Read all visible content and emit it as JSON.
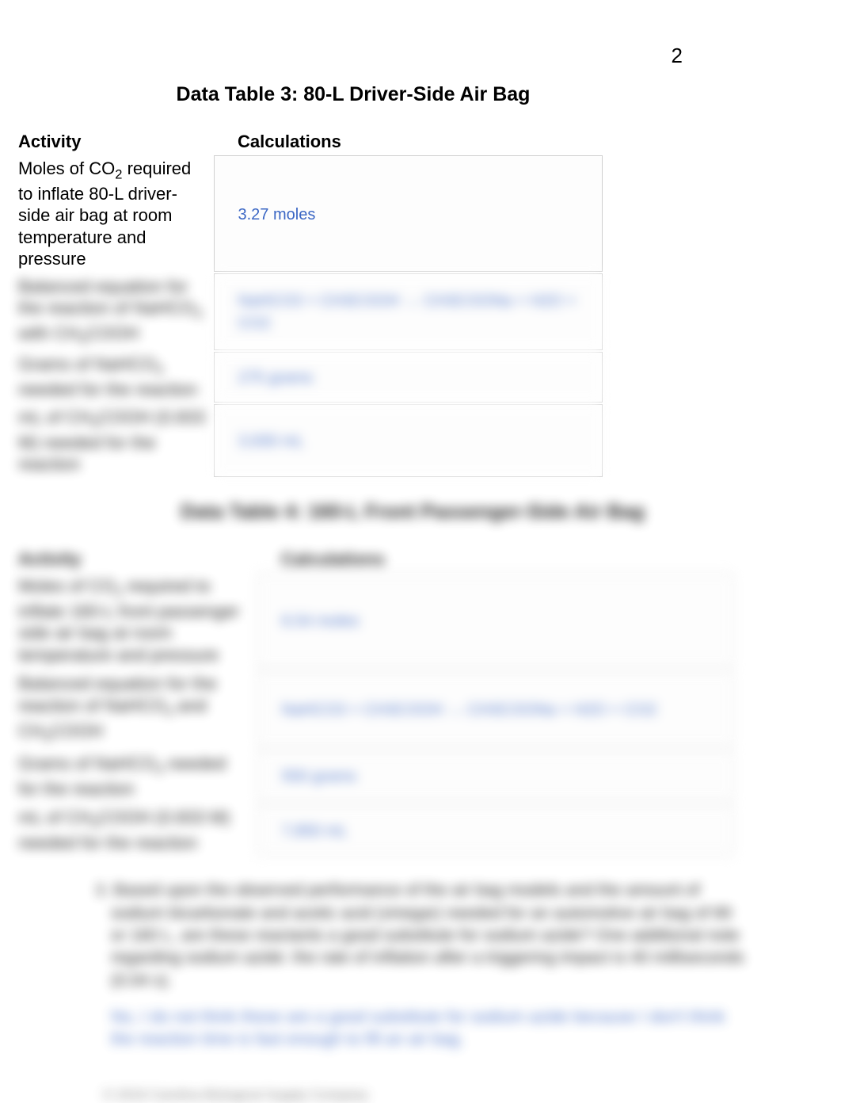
{
  "page_number": "2",
  "table3": {
    "title": "Data Table 3: 80-L Driver-Side Air Bag",
    "headers": {
      "activity": "Activity",
      "calculations": "Calculations"
    },
    "rows": [
      {
        "activity_html": "Moles of CO<sub>2</sub> required to inflate 80-L driver-side air bag at room temperature and pressure",
        "calc": "3.27 moles"
      },
      {
        "activity_html": "Balanced equation for the reaction of NaHCO<sub>3</sub> with CH<sub>3</sub>COOH",
        "calc": "NaHCO3 + CH3COOH → CH3COONa + H2O + CO2"
      },
      {
        "activity_html": "Grams of NaHCO<sub>3</sub> needed for the reaction",
        "calc": "275 grams"
      },
      {
        "activity_html": "mL of CH<sub>3</sub>COOH (0.833 M) needed for the reaction",
        "calc": "3,930 mL"
      }
    ]
  },
  "table4": {
    "title": "Data Table 4: 160-L Front Passenger-Side Air Bag",
    "headers": {
      "activity": "Activity",
      "calculations": "Calculations"
    },
    "rows": [
      {
        "activity_html": "Moles of CO<sub>2</sub> required to inflate 160-L front passenger side air bag at room temperature and pressure",
        "calc": "6.54 moles"
      },
      {
        "activity_html": "Balanced equation for the reaction of NaHCO<sub>3</sub> and CH<sub>3</sub>COOH",
        "calc": "NaHCO3 + CH3COOH → CH3COONa + H2O + CO2"
      },
      {
        "activity_html": "Grams of NaHCO<sub>3</sub> needed for the reaction",
        "calc": "550 grams"
      },
      {
        "activity_html": "mL of CH<sub>3</sub>COOH (0.833 M) needed for the reaction",
        "calc": "7,850 mL"
      }
    ]
  },
  "question": {
    "number": "3.",
    "text": "Based upon the observed performance of the air bag models and the amount of sodium bicarbonate and acetic acid (vinegar) needed for an automotive air bag of 80 or 160 L, are these reactants a good substitute for sodium azide? One additional note regarding sodium azide: the rate of inflation after a triggering impact is 40 milliseconds (0.04 s).",
    "answer": "No, I do not think these are a good substitute for sodium azide because I don't think the reaction time is fast enough to fill an air bag."
  },
  "copyright": "© 2016 Carolina Biological Supply Company"
}
